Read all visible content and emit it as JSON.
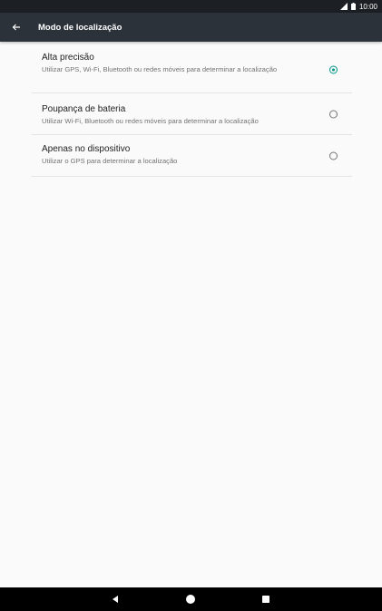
{
  "status_bar": {
    "time": "10:00",
    "icons": [
      "signal-icon",
      "battery-icon"
    ]
  },
  "app_bar": {
    "back_icon": "arrow-back-icon",
    "title": "Modo de localização"
  },
  "options": [
    {
      "title": "Alta precisão",
      "subtitle": "Utilizar GPS, Wi-Fi, Bluetooth ou redes móveis para determinar a localização",
      "selected": true
    },
    {
      "title": "Poupança de bateria",
      "subtitle": "Utilizar Wi-Fi, Bluetooth ou redes móveis para determinar a localização",
      "selected": false
    },
    {
      "title": "Apenas no dispositivo",
      "subtitle": "Utilizar o GPS para determinar a localização",
      "selected": false
    }
  ],
  "nav_bar": {
    "icons": [
      "back-triangle-icon",
      "home-circle-icon",
      "recents-square-icon"
    ]
  },
  "colors": {
    "accent": "#009688",
    "app_bar": "#2b3239",
    "status_bar": "#1c2024",
    "background": "#fafafa"
  }
}
